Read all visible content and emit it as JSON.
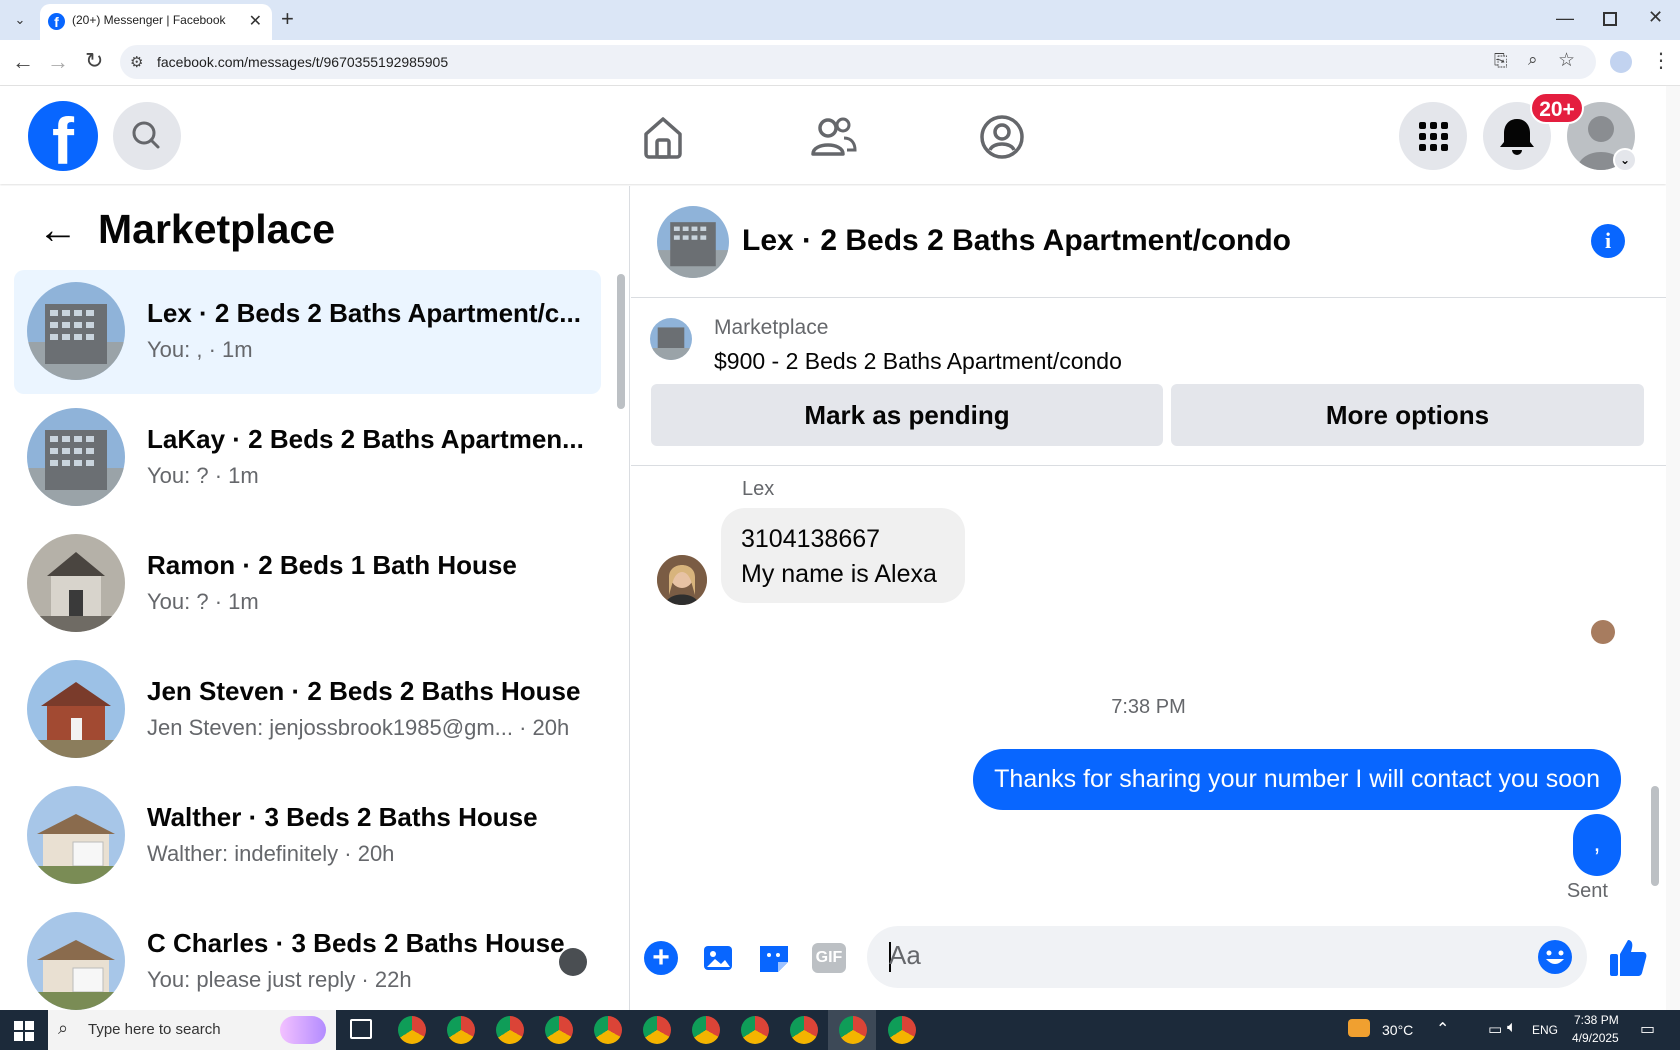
{
  "browser": {
    "tab_title": "(20+) Messenger | Facebook",
    "url": "facebook.com/messages/t/9670355192985905"
  },
  "header": {
    "notification_badge": "20+"
  },
  "sidebar": {
    "title": "Marketplace",
    "conversations": [
      {
        "title": "Lex · 2 Beds 2 Baths Apartment/c...",
        "snippet": "You: , · 1m",
        "active": true
      },
      {
        "title": "LaKay · 2 Beds 2 Baths Apartmen...",
        "snippet": "You: ? · 1m",
        "active": false
      },
      {
        "title": "Ramon · 2 Beds 1 Bath House",
        "snippet": "You: ? · 1m",
        "active": false
      },
      {
        "title": "Jen Steven · 2 Beds 2 Baths House",
        "snippet": "Jen Steven: jenjossbrook1985@gm... · 20h",
        "active": false
      },
      {
        "title": "Walther · 3 Beds 2 Baths House",
        "snippet": "Walther: indefinitely · 20h",
        "active": false
      },
      {
        "title": "C Charles · 3 Beds 2 Baths House",
        "snippet": "You: please just reply · 22h",
        "active": false
      }
    ]
  },
  "chat": {
    "title": "Lex · 2 Beds 2 Baths Apartment/condo",
    "listing_source": "Marketplace",
    "listing_title": "$900 - 2 Beds 2 Baths Apartment/condo",
    "mark_pending_label": "Mark as pending",
    "more_options_label": "More options",
    "sender_name": "Lex",
    "incoming_line1": "3104138667",
    "incoming_line2": "My name is Alexa",
    "timestamp": "7:38 PM",
    "outgoing_1": "Thanks for sharing your number I will contact you soon",
    "outgoing_2": ",",
    "status": "Sent",
    "composer_placeholder": "Aa",
    "gif_label": "GIF"
  },
  "taskbar": {
    "search_placeholder": "Type here to search",
    "weather": "30°C",
    "language": "ENG",
    "time": "7:38 PM",
    "date": "4/9/2025"
  },
  "colors": {
    "brand_blue": "#0866ff",
    "active_conv": "#ebf5ff",
    "badge_red": "#e41e3f"
  }
}
